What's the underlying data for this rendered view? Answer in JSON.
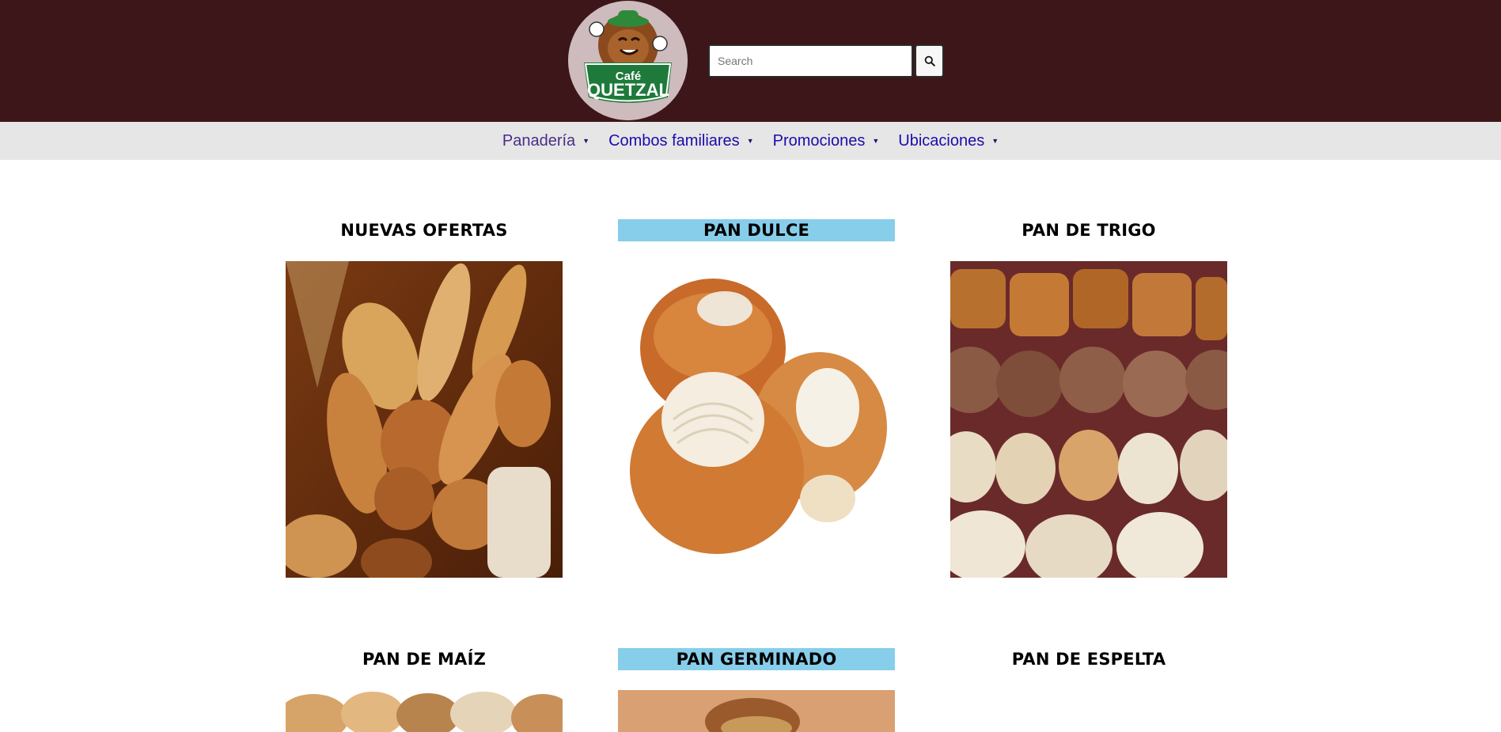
{
  "header": {
    "logo": {
      "line1": "Café",
      "line2": "QUETZAL",
      "colors": {
        "badge_bg": "#cdbbbd",
        "ribbon": "#1e7a3a",
        "mascot": "#8a4a1e"
      }
    },
    "search": {
      "placeholder": "Search",
      "value": "",
      "icon": "search-icon"
    },
    "colors": {
      "background": "#3d1619"
    }
  },
  "nav": {
    "items": [
      {
        "label": "Panadería",
        "caret": "▼",
        "icon": "caret-down-icon"
      },
      {
        "label": "Combos familiares",
        "caret": "▼",
        "icon": "caret-down-icon"
      },
      {
        "label": "Promociones",
        "caret": "▼",
        "icon": "caret-down-icon"
      },
      {
        "label": "Ubicaciones",
        "caret": "▼",
        "icon": "caret-down-icon"
      }
    ],
    "colors": {
      "background": "#e6e6e6",
      "link": "#1a0dab",
      "visited": "#4a2c8a"
    }
  },
  "categories": [
    {
      "title": "NUEVAS OFERTAS",
      "highlighted": false,
      "image": "bread-assortment-basket"
    },
    {
      "title": "PAN DULCE",
      "highlighted": true,
      "image": "conchas-sweet-bread"
    },
    {
      "title": "PAN DE TRIGO",
      "highlighted": false,
      "image": "pastries-and-conchas-rows"
    },
    {
      "title": "PAN DE MAÍZ",
      "highlighted": false,
      "image": "assorted-bread-rolls"
    },
    {
      "title": "PAN GERMINADO",
      "highlighted": true,
      "image": "sprouted-bread-loaf"
    },
    {
      "title": "PAN DE ESPELTA",
      "highlighted": false,
      "image": ""
    }
  ],
  "colors": {
    "highlight": "#87ceeb"
  }
}
